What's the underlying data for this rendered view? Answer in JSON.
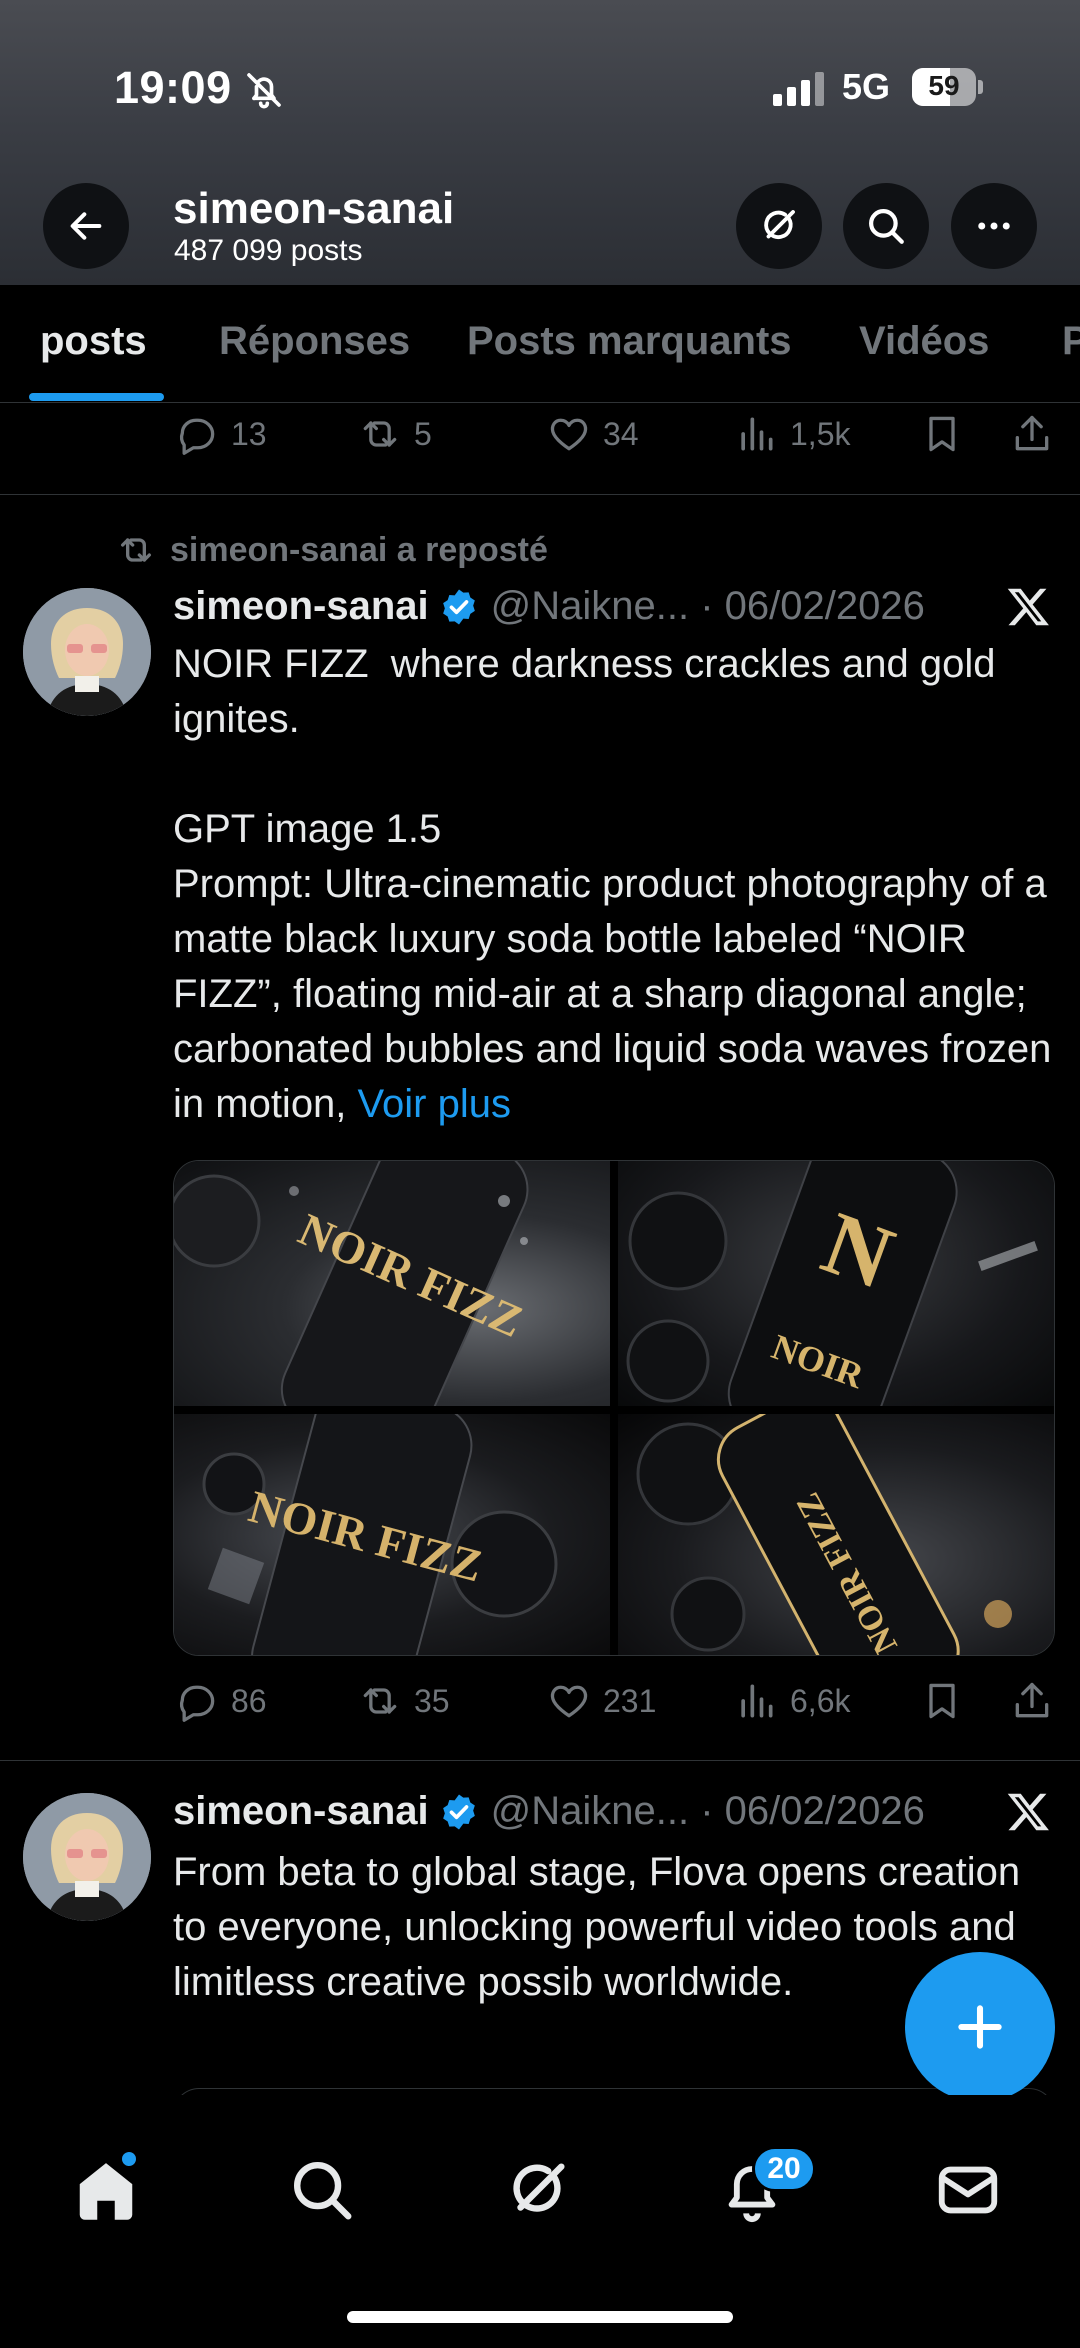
{
  "status_bar": {
    "time": "19:09",
    "network": "5G",
    "battery": "59",
    "battery_level": 0.59
  },
  "header": {
    "profile_name": "simeon-sanai",
    "post_count": "487 099 posts"
  },
  "tabs": [
    {
      "label": "posts",
      "active": true
    },
    {
      "label": "Réponses",
      "active": false
    },
    {
      "label": "Posts marquants",
      "active": false
    },
    {
      "label": "Vidéos",
      "active": false
    },
    {
      "label": "P",
      "active": false
    }
  ],
  "prev_post_actions": {
    "replies": "13",
    "reposts": "5",
    "likes": "34",
    "views": "1,5k"
  },
  "posts": [
    {
      "repost_label": "simeon-sanai a reposté",
      "author": "simeon-sanai",
      "handle": "@Naikne... · 06/02/2026",
      "text": "NOIR FIZZ  where darkness crackles and gold ignites.\n\nGPT image 1.5\nPrompt: Ultra-cinematic product photography of a matte black luxury soda bottle labeled “NOIR FIZZ”, floating mid-air at a sharp diagonal angle; carbonated bubbles and liquid soda waves frozen in motion, ",
      "see_more": "Voir plus",
      "media": [
        {
          "caption": "NOIR FIZZ"
        },
        {
          "caption": "NOIR"
        },
        {
          "caption": "NOIR FIZZ"
        },
        {
          "caption": "NOIR FIZZ"
        }
      ],
      "actions": {
        "replies": "86",
        "reposts": "35",
        "likes": "231",
        "views": "6,6k"
      }
    },
    {
      "author": "simeon-sanai",
      "handle": "@Naikne... · 06/02/2026",
      "text": "From beta to global stage, Flova opens creation to everyone, unlocking powerful video tools and limitless creative possib worldwide."
    }
  ],
  "bottom_nav": {
    "notification_count": "20"
  },
  "colors": {
    "accent": "#1d9bf0",
    "background": "#000000",
    "muted": "#71767b",
    "text": "#e7e9ea"
  }
}
